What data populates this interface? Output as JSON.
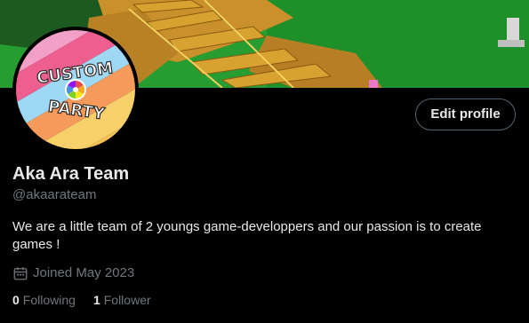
{
  "profile": {
    "display_name": "Aka Ara Team",
    "handle": "@akaarateam",
    "bio": "We are a little team of 2 youngs game-developpers and our passion is to create games !",
    "joined": "Joined May 2023",
    "edit_profile_label": "Edit profile"
  },
  "avatar": {
    "logo_line1": "CUSTOM",
    "logo_line2": "PARTY"
  },
  "stats": {
    "following_count": "0",
    "following_label": "Following",
    "followers_count": "1",
    "followers_label": "Follower"
  },
  "icons": {
    "calendar": "calendar-icon"
  },
  "colors": {
    "background": "#000000",
    "primary_text": "#e7e9ea",
    "secondary_text": "#71767b",
    "button_border": "#536471"
  }
}
